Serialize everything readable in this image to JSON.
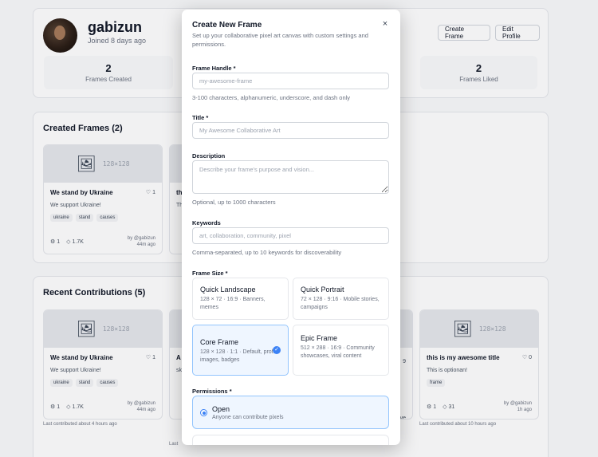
{
  "profile": {
    "username": "gabizun",
    "joined": "Joined 8 days ago",
    "create_frame_label": "Create Frame",
    "edit_profile_label": "Edit Profile",
    "stats": [
      {
        "value": "2",
        "label": "Frames Created"
      },
      {
        "value": "2",
        "label": "Frames Liked"
      }
    ]
  },
  "created_section": {
    "title": "Created Frames (2)",
    "cards": [
      {
        "size": "128×128",
        "title": "We stand by Ukraine",
        "likes": "1",
        "description": "We support Ukraine!",
        "tags": [
          "ukraine",
          "stand",
          "causes"
        ],
        "contributors": "1",
        "pixels": "1.7K",
        "by": "by @gabizun",
        "age": "44m ago"
      },
      {
        "title_partial": "th",
        "desc_partial": "Th"
      }
    ]
  },
  "recent_section": {
    "title": "Recent Contributions (5)",
    "cards": [
      {
        "size": "128×128",
        "title": "We stand by Ukraine",
        "likes": "1",
        "description": "We support Ukraine!",
        "tags": [
          "ukraine",
          "stand",
          "causes"
        ],
        "contributors": "1",
        "pixels": "1.7K",
        "by": "by @gabizun",
        "age": "44m ago",
        "last_contributed": "Last contributed about 4 hours ago"
      },
      {
        "size": "128×128",
        "title": "this is my awesome title",
        "likes": "0",
        "description": "This is optionan!",
        "tags": [
          "frame"
        ],
        "contributors": "1",
        "pixels": "31",
        "by": "by @gabizun",
        "age": "1h ago",
        "last_contributed": "Last contributed about 10 hours ago"
      }
    ],
    "partials": {
      "card2_title": "A",
      "card2_desc": "sk",
      "card2_footer": "Last",
      "card4_right_count": "9",
      "card4_right_a": "ve",
      "card4_right_b": "nt"
    }
  },
  "modal": {
    "title": "Create New Frame",
    "close_symbol": "×",
    "subtitle": "Set up your collaborative pixel art canvas with custom settings and permissions.",
    "handle": {
      "label": "Frame Handle *",
      "placeholder": "my-awesome-frame",
      "help": "3-100 characters, alphanumeric, underscore, and dash only"
    },
    "title_field": {
      "label": "Title *",
      "placeholder": "My Awesome Collaborative Art"
    },
    "description": {
      "label": "Description",
      "placeholder": "Describe your frame's purpose and vision...",
      "help": "Optional, up to 1000 characters"
    },
    "keywords": {
      "label": "Keywords",
      "placeholder": "art, collaboration, community, pixel",
      "help": "Comma-separated, up to 10 keywords for discoverability"
    },
    "frame_size": {
      "label": "Frame Size *",
      "options": [
        {
          "name": "Quick Landscape",
          "desc": "128 × 72 · 16:9 · Banners, memes"
        },
        {
          "name": "Quick Portrait",
          "desc": "72 × 128 · 9:16 · Mobile stories, campaigns"
        },
        {
          "name": "Core Frame",
          "desc": "128 × 128 · 1:1 · Default, profile images, badges",
          "selected": true
        },
        {
          "name": "Epic Frame",
          "desc": "512 × 288 · 16:9 · Community showcases, viral content"
        }
      ]
    },
    "permissions": {
      "label": "Permissions *",
      "options": [
        {
          "name": "Open",
          "desc": "Anyone can contribute pixels",
          "selected": true
        }
      ]
    }
  },
  "icons": {
    "easel": "easel-icon",
    "heart": "heart-icon",
    "users": "users-icon",
    "tag": "tag-icon",
    "check": "check-icon",
    "close": "close-icon"
  },
  "colors": {
    "accent": "#3b82f6",
    "selected_bg": "#eff6ff",
    "selected_border": "#93c5fd"
  }
}
